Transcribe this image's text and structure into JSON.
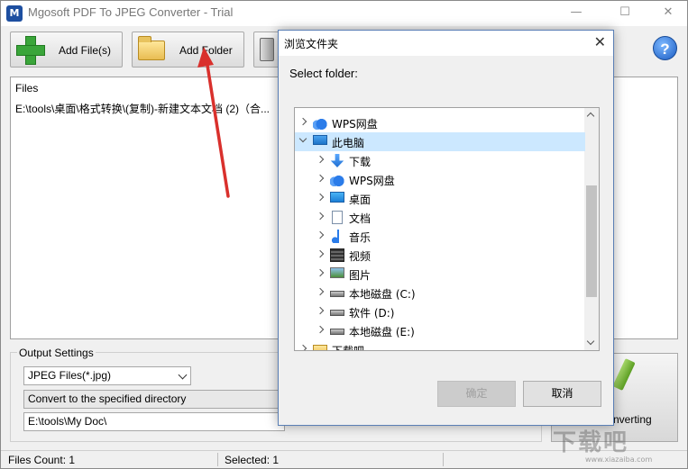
{
  "app": {
    "title": "Mgosoft PDF To JPEG Converter - Trial",
    "icon_letter": "M",
    "window_controls": {
      "minimize": "—",
      "maximize": "☐",
      "close": "✕"
    }
  },
  "toolbar": {
    "add_files_label": "Add File(s)",
    "add_folder_label": "Add Folder",
    "help_label": "?"
  },
  "files": {
    "header": "Files",
    "rows": [
      "E:\\tools\\桌面\\格式转换\\(复制)-新建文本文档 (2)（合..."
    ]
  },
  "output": {
    "legend": "Output Settings",
    "format_value": "JPEG Files(*.jpg)",
    "mode_value": "Convert to the specified directory",
    "directory_value": "E:\\tools\\My Doc\\",
    "start_label": "nverting"
  },
  "statusbar": {
    "files_count": "Files Count: 1",
    "selected": "Selected: 1"
  },
  "dialog": {
    "title": "浏览文件夹",
    "close": "✕",
    "prompt": "Select folder:",
    "tree": [
      {
        "label": "WPS网盘",
        "icon": "cloud-icon",
        "level": 0,
        "expanded": false
      },
      {
        "label": "此电脑",
        "icon": "computer-icon",
        "level": 0,
        "expanded": true,
        "selected": true
      },
      {
        "label": "下载",
        "icon": "download-icon",
        "level": 1,
        "expanded": false
      },
      {
        "label": "WPS网盘",
        "icon": "cloud-icon",
        "level": 1,
        "expanded": false
      },
      {
        "label": "桌面",
        "icon": "desktop-icon",
        "level": 1,
        "expanded": false
      },
      {
        "label": "文档",
        "icon": "document-icon",
        "level": 1,
        "expanded": false
      },
      {
        "label": "音乐",
        "icon": "music-icon",
        "level": 1,
        "expanded": false
      },
      {
        "label": "视频",
        "icon": "video-icon",
        "level": 1,
        "expanded": false
      },
      {
        "label": "图片",
        "icon": "picture-icon",
        "level": 1,
        "expanded": false
      },
      {
        "label": "本地磁盘 (C:)",
        "icon": "system-drive-icon",
        "level": 1,
        "expanded": false
      },
      {
        "label": "软件 (D:)",
        "icon": "drive-icon",
        "level": 1,
        "expanded": false
      },
      {
        "label": "本地磁盘 (E:)",
        "icon": "drive-icon",
        "level": 1,
        "expanded": false
      },
      {
        "label": "下载吧",
        "icon": "folder-icon",
        "level": 0,
        "expanded": false
      }
    ],
    "ok_label": "确定",
    "cancel_label": "取消"
  },
  "watermark": {
    "text": "下载吧",
    "sub": "www.xiazaiba.com"
  },
  "colors": {
    "selection": "#cce8ff",
    "arrow": "#d9302c",
    "dialog_border": "#5a7fb5"
  }
}
